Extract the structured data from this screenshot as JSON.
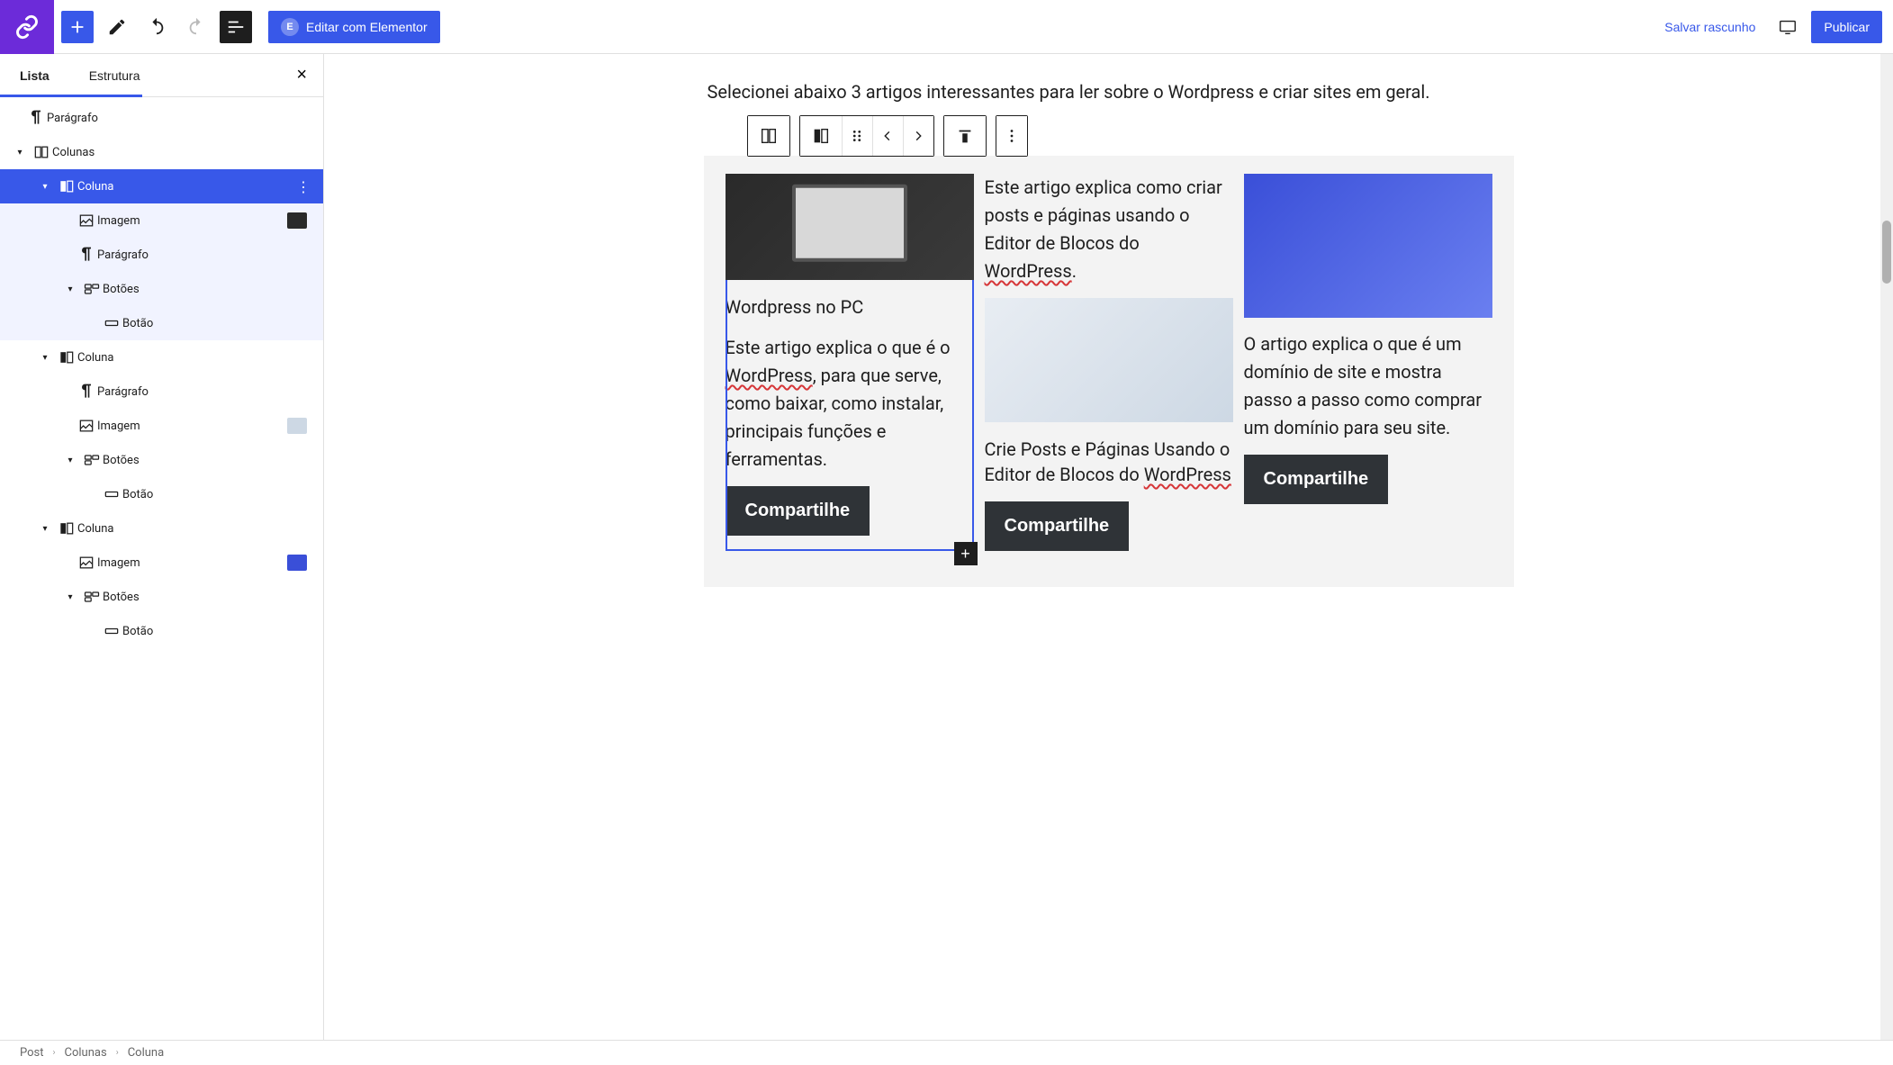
{
  "toolbar": {
    "edit_elementor": "Editar com Elementor",
    "save_draft": "Salvar rascunho",
    "publish": "Publicar"
  },
  "sidebar": {
    "tabs": {
      "list": "Lista",
      "structure": "Estrutura"
    },
    "items": [
      {
        "label": "Parágrafo",
        "indent": 1,
        "icon": "paragraph"
      },
      {
        "label": "Colunas",
        "indent": 1,
        "icon": "columns",
        "caret": true
      },
      {
        "label": "Coluna",
        "indent": 2,
        "icon": "column",
        "caret": true,
        "selected": true
      },
      {
        "label": "Imagem",
        "indent": 3,
        "icon": "image",
        "thumb": "#2a2a2a"
      },
      {
        "label": "Parágrafo",
        "indent": 3,
        "icon": "paragraph"
      },
      {
        "label": "Botões",
        "indent": 3,
        "icon": "buttons",
        "caret": true
      },
      {
        "label": "Botão",
        "indent": 4,
        "icon": "button"
      },
      {
        "label": "Coluna",
        "indent": 2,
        "icon": "column",
        "caret": true
      },
      {
        "label": "Parágrafo",
        "indent": 3,
        "icon": "paragraph"
      },
      {
        "label": "Imagem",
        "indent": 3,
        "icon": "image",
        "thumb": "#cdd8e4"
      },
      {
        "label": "Botões",
        "indent": 3,
        "icon": "buttons",
        "caret": true
      },
      {
        "label": "Botão",
        "indent": 4,
        "icon": "button"
      },
      {
        "label": "Coluna",
        "indent": 2,
        "icon": "column",
        "caret": true
      },
      {
        "label": "Imagem",
        "indent": 3,
        "icon": "image",
        "thumb": "#3a4fd8"
      },
      {
        "label": "Botões",
        "indent": 3,
        "icon": "buttons",
        "caret": true
      },
      {
        "label": "Botão",
        "indent": 4,
        "icon": "button"
      }
    ]
  },
  "editor": {
    "intro": "Selecionei abaixo 3 artigos interessantes para ler sobre o Wordpress e criar sites em geral.",
    "columns": [
      {
        "title": "Wordpress no PC",
        "text_before": "Este artigo explica o que é o ",
        "squiggly": "WordPress",
        "text_after": ", para que serve, como baixar, como instalar, principais funções e ferramentas.",
        "button": "Compartilhe"
      },
      {
        "top_before": "Este artigo explica como criar posts e páginas usando o Editor de Blocos do ",
        "top_squiggly": "WordPress",
        "top_after": ".",
        "title_before": "Crie Posts e Páginas Usando o Editor de Blocos do ",
        "title_squiggly": "WordPress",
        "button": "Compartilhe"
      },
      {
        "text": "O artigo explica o que é um domínio de site e mostra passo a passo como comprar um domínio para seu site.",
        "button": "Compartilhe"
      }
    ]
  },
  "breadcrumb": {
    "a": "Post",
    "b": "Colunas",
    "c": "Coluna"
  }
}
